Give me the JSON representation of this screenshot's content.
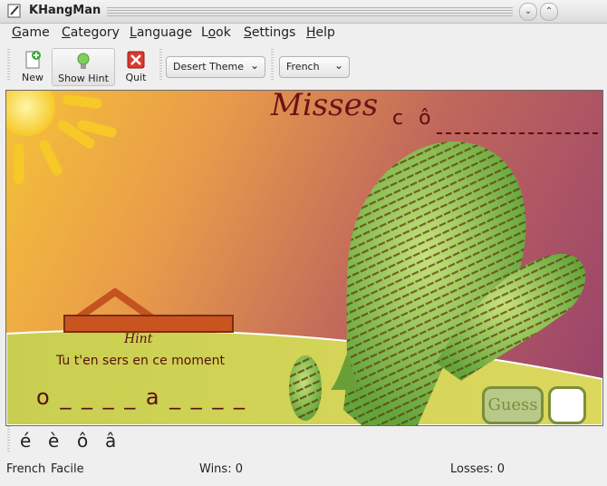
{
  "window": {
    "title": "KHangMan"
  },
  "menubar": {
    "items": [
      {
        "pre": "",
        "ul": "G",
        "post": "ame"
      },
      {
        "pre": "",
        "ul": "C",
        "post": "ategory"
      },
      {
        "pre": "",
        "ul": "L",
        "post": "anguage"
      },
      {
        "pre": "L",
        "ul": "o",
        "post": "ok"
      },
      {
        "pre": "",
        "ul": "S",
        "post": "ettings"
      },
      {
        "pre": "",
        "ul": "H",
        "post": "elp"
      }
    ]
  },
  "toolbar": {
    "new_label": "New",
    "hint_label": "Show Hint",
    "quit_label": "Quit",
    "theme_value": "Desert Theme",
    "language_value": "French"
  },
  "game": {
    "misses_label": "Misses",
    "missed_letters": "c ô",
    "hint_label": "Hint",
    "hint_text": "Tu t'en sers en ce moment",
    "word_display": "o _ _ _ _  a  _ _ _ _",
    "guess_label": "Guess"
  },
  "special_chars": [
    "é",
    "è",
    "ô",
    "â"
  ],
  "status": {
    "language": "French",
    "level": "Facile",
    "wins": "Wins: 0",
    "losses": "Losses: 0"
  }
}
